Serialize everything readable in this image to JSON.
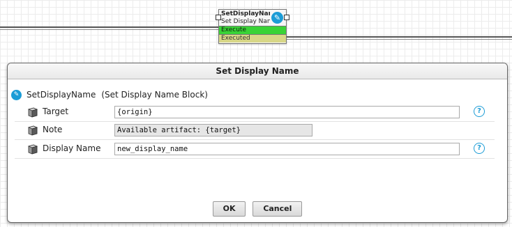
{
  "canvas": {
    "node": {
      "title": "SetDisplayNam",
      "subtitle": "Set Display Nan",
      "execute_label": "Execute",
      "executed_label": "Executed",
      "icon": "pencil-icon"
    }
  },
  "dialog": {
    "title": "Set Display Name",
    "block": {
      "name": "SetDisplayName",
      "type": "(Set Display Name Block)",
      "icon": "pencil-icon"
    },
    "properties": [
      {
        "label": "Target",
        "value": "{origin}",
        "readonly": false,
        "help": "?"
      },
      {
        "label": "Note",
        "value": "Available artifact: {target}",
        "readonly": true
      },
      {
        "label": "Display Name",
        "value": "new_display_name",
        "readonly": false,
        "help": "?"
      }
    ],
    "buttons": {
      "ok": "OK",
      "cancel": "Cancel"
    }
  },
  "colors": {
    "accent": "#1c9cd6",
    "execute": "#39d336",
    "executed": "#d8d787"
  }
}
